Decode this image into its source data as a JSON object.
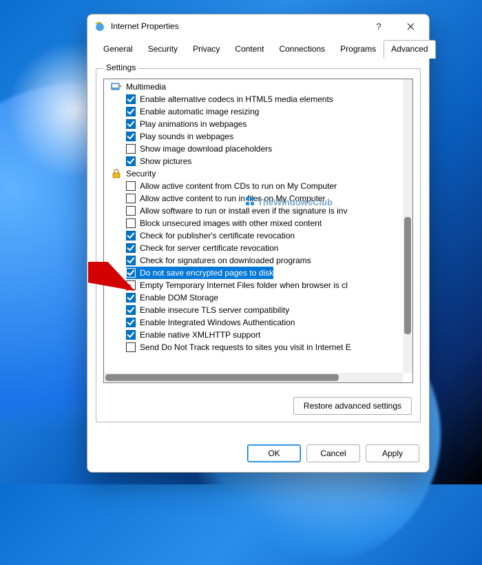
{
  "window": {
    "title": "Internet Properties",
    "help": "?",
    "close": "✕"
  },
  "tabs": [
    "General",
    "Security",
    "Privacy",
    "Content",
    "Connections",
    "Programs",
    "Advanced"
  ],
  "active_tab": 6,
  "group": {
    "label": "Settings"
  },
  "tree": {
    "categories": [
      {
        "icon": "multimedia-icon",
        "label": "Multimedia",
        "items": [
          {
            "checked": true,
            "label": "Enable alternative codecs in HTML5 media elements"
          },
          {
            "checked": true,
            "label": "Enable automatic image resizing"
          },
          {
            "checked": true,
            "label": "Play animations in webpages"
          },
          {
            "checked": true,
            "label": "Play sounds in webpages"
          },
          {
            "checked": false,
            "label": "Show image download placeholders"
          },
          {
            "checked": true,
            "label": "Show pictures"
          }
        ]
      },
      {
        "icon": "lock-icon",
        "label": "Security",
        "items": [
          {
            "checked": false,
            "label": "Allow active content from CDs to run on My Computer"
          },
          {
            "checked": false,
            "label": "Allow active content to run in files on My Computer"
          },
          {
            "checked": false,
            "label": "Allow software to run or install even if the signature is inv"
          },
          {
            "checked": false,
            "label": "Block unsecured images with other mixed content"
          },
          {
            "checked": true,
            "label": "Check for publisher's certificate revocation"
          },
          {
            "checked": true,
            "label": "Check for server certificate revocation"
          },
          {
            "checked": true,
            "label": "Check for signatures on downloaded programs"
          },
          {
            "checked": true,
            "label": "Do not save encrypted pages to disk",
            "selected": true
          },
          {
            "checked": false,
            "label": "Empty Temporary Internet Files folder when browser is cl"
          },
          {
            "checked": true,
            "label": "Enable DOM Storage"
          },
          {
            "checked": true,
            "label": "Enable insecure TLS server compatibility"
          },
          {
            "checked": true,
            "label": "Enable Integrated Windows Authentication"
          },
          {
            "checked": true,
            "label": "Enable native XMLHTTP support"
          },
          {
            "checked": false,
            "label": "Send Do Not Track requests to sites you visit in Internet E"
          }
        ]
      }
    ]
  },
  "buttons": {
    "restore": "Restore advanced settings",
    "ok": "OK",
    "cancel": "Cancel",
    "apply": "Apply"
  },
  "watermark": "TheWindowsClub"
}
